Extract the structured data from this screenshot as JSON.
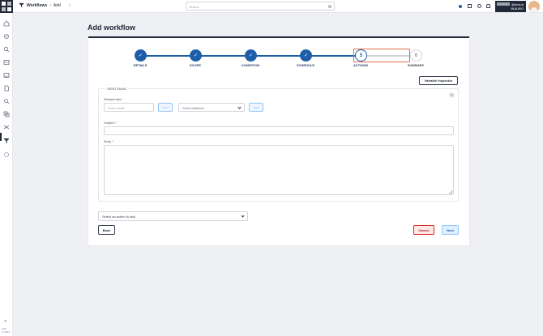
{
  "header": {
    "breadcrumb": [
      "Workflows",
      "Add"
    ],
    "search_placeholder": "Search",
    "user_line1": "@sheuh",
    "user_line2": "INAURO"
  },
  "sidebar": {
    "icons": [
      "home-icon",
      "gear-icon",
      "search-icon",
      "table-icon",
      "inbox-icon",
      "document-icon",
      "magnify-icon",
      "copy-icon",
      "network-icon",
      "workflow-icon",
      "settings-icon"
    ],
    "active_index": 9,
    "version_line1": "v.26",
    "version_line2": "© 2024"
  },
  "page": {
    "title": "Add workflow"
  },
  "stepper": {
    "steps": [
      {
        "label": "DETAILS",
        "state": "done"
      },
      {
        "label": "SCOPE",
        "state": "done"
      },
      {
        "label": "CONDITION",
        "state": "done"
      },
      {
        "label": "SCHEDULE",
        "state": "done"
      },
      {
        "label": "ACTIONS",
        "state": "current",
        "number": "5"
      },
      {
        "label": "SUMMARY",
        "state": "future",
        "number": "6"
      }
    ]
  },
  "variable_inspector_label": "Variable Inspector",
  "send_email": {
    "title": "SEND EMAIL",
    "recipients_label": "Recipient(s)",
    "email_placeholder": "Enter email",
    "add_label": "Add",
    "attribute_placeholder": "Select attribute",
    "add_label_2": "Add",
    "subject_label": "Subject",
    "body_label": "Body"
  },
  "action_select_placeholder": "Select an action to add",
  "footer": {
    "back_label": "Back",
    "cancel_label": "Cancel",
    "next_label": "Next"
  },
  "colors": {
    "primary": "#1e5ea8",
    "highlight": "#e06a4a",
    "danger": "#dc2626"
  }
}
